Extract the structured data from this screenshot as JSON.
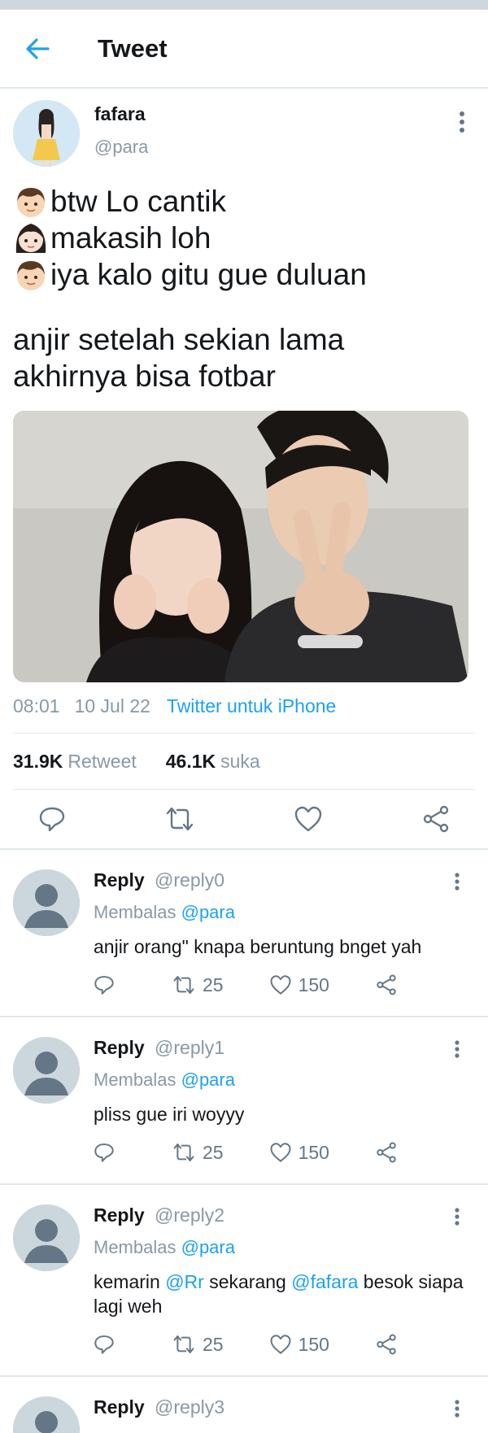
{
  "header": {
    "title": "Tweet"
  },
  "tweet": {
    "author_name": "fafara",
    "author_handle": "@para",
    "lines": [
      {
        "emoji": "boy-emoji",
        "text": "btw Lo cantik"
      },
      {
        "emoji": "girl-emoji",
        "text": "makasih loh"
      },
      {
        "emoji": "boy-emoji",
        "text": "iya kalo gitu gue duluan"
      }
    ],
    "body_lines": [
      "anjir setelah sekian lama",
      "akhirnya bisa fotbar"
    ],
    "time": "08:01",
    "date": "10 Jul 22",
    "source": "Twitter untuk iPhone",
    "retweet_count": "31.9K",
    "retweet_label": "Retweet",
    "like_count": "46.1K",
    "like_label": "suka"
  },
  "replies": [
    {
      "name": "Reply",
      "handle": "@reply0",
      "replying_prefix": "Membalas",
      "replying_to": "@para",
      "text_parts": [
        {
          "text": "anjir orang\" knapa beruntung bnget yah",
          "mention": false
        }
      ],
      "retweets": "25",
      "likes": "150"
    },
    {
      "name": "Reply",
      "handle": "@reply1",
      "replying_prefix": "Membalas",
      "replying_to": "@para",
      "text_parts": [
        {
          "text": "pliss gue iri woyyy",
          "mention": false
        }
      ],
      "retweets": "25",
      "likes": "150"
    },
    {
      "name": "Reply",
      "handle": "@reply2",
      "replying_prefix": "Membalas",
      "replying_to": "@para",
      "text_parts": [
        {
          "text": "kemarin ",
          "mention": false
        },
        {
          "text": "@Rr",
          "mention": true
        },
        {
          "text": " sekarang ",
          "mention": false
        },
        {
          "text": "@fafara",
          "mention": true
        },
        {
          "text": " besok siapa lagi weh",
          "mention": false
        }
      ],
      "retweets": "25",
      "likes": "150"
    },
    {
      "name": "Reply",
      "handle": "@reply3"
    }
  ],
  "colors": {
    "accent": "#1da1f2",
    "muted": "#8899a6",
    "divider": "#e1e8ed"
  }
}
